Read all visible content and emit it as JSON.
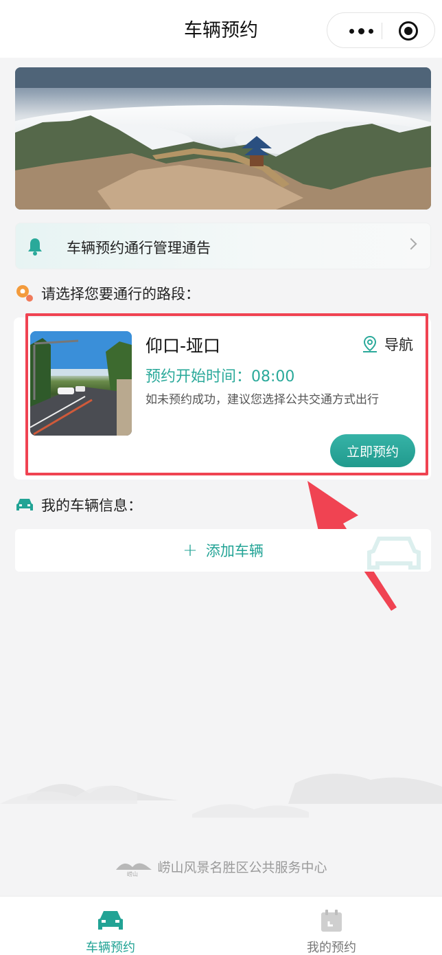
{
  "header": {
    "title": "车辆预约"
  },
  "notice": {
    "text": "车辆预约通行管理通告"
  },
  "sections": {
    "route_title": "请选择您要通行的路段：",
    "vehicle_title": "我的车辆信息："
  },
  "route_card": {
    "name": "仰口-垭口",
    "nav_label": "导航",
    "start_time": "预约开始时间：08:00",
    "description": "如未预约成功，建议您选择公共交通方式出行",
    "button_label": "立即预约"
  },
  "vehicle": {
    "add_label": "添加车辆"
  },
  "footer": {
    "org_name": "崂山风景名胜区公共服务中心",
    "logo_text": "崂山"
  },
  "tabbar": {
    "items": [
      {
        "label": "车辆预约",
        "icon": "car-icon",
        "active": true
      },
      {
        "label": "我的预约",
        "icon": "calendar-icon",
        "active": false
      }
    ]
  },
  "colors": {
    "accent": "#22a395",
    "highlight_border": "#f04352",
    "arrow": "#f04352"
  }
}
